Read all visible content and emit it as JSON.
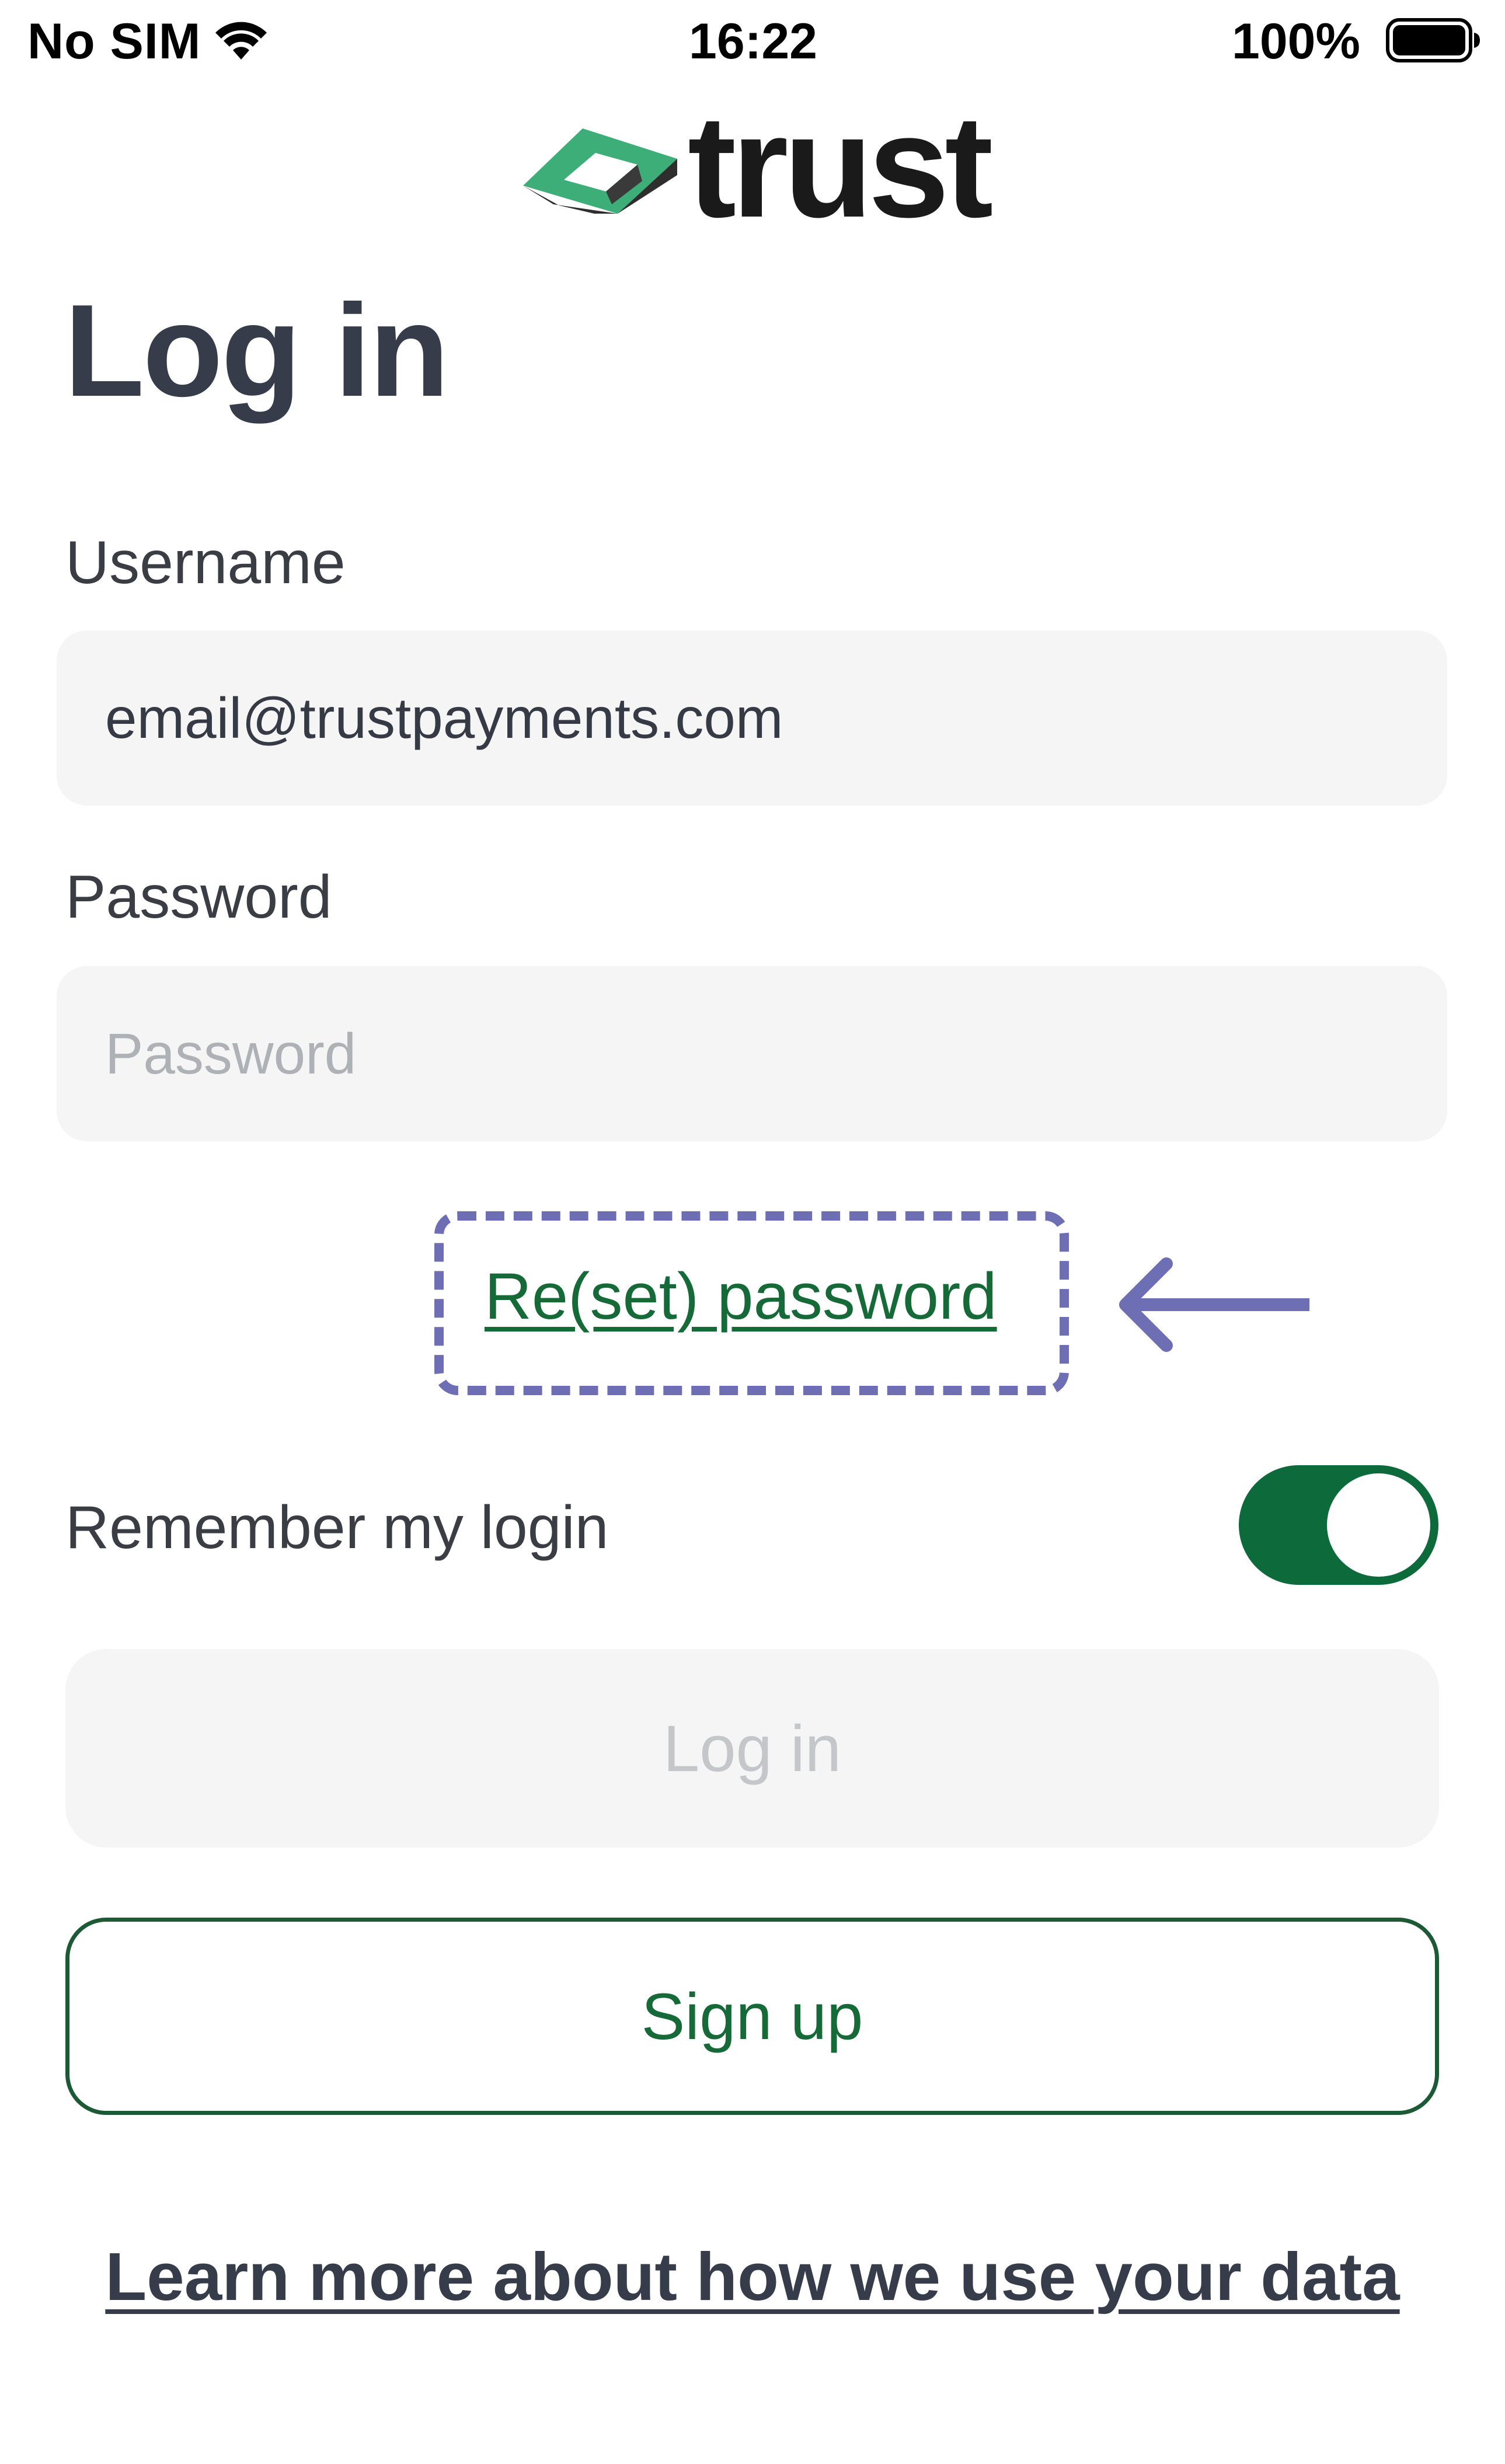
{
  "status_bar": {
    "carrier": "No SIM",
    "time": "16:22",
    "battery": "100%",
    "wifi_icon": "wifi-icon",
    "battery_icon": "battery-full-icon"
  },
  "logo": {
    "wordmark": "trust",
    "icon": "trust-logo-mark-icon",
    "colors": {
      "green": "#3dae78",
      "dark": "#333333"
    }
  },
  "page": {
    "title": "Log in"
  },
  "form": {
    "username_label": "Username",
    "username_value": "email@trustpayments.com",
    "password_label": "Password",
    "password_placeholder": "Password",
    "reset_link": "Re(set) password",
    "remember_label": "Remember my login",
    "remember_enabled": true
  },
  "annotation": {
    "highlight_color": "#6e6eb5",
    "arrow_icon": "arrow-left-icon"
  },
  "buttons": {
    "login": "Log in",
    "signup": "Sign up"
  },
  "footer": {
    "data_link": "Learn more about how we use your data"
  },
  "colors": {
    "brand_green": "#0d6a3b",
    "text_dark": "#363c4a",
    "input_bg": "#f5f5f5"
  }
}
